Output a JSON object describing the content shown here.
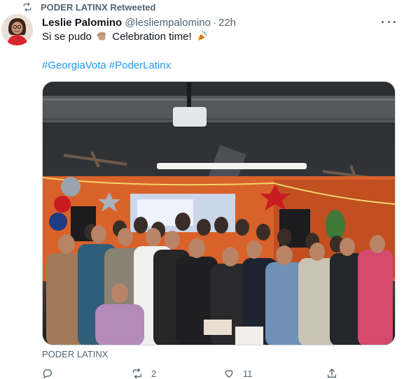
{
  "retweet_banner": {
    "label": "PODER LATINX Retweeted",
    "icon": "retweet-icon"
  },
  "tweet": {
    "author_name": "Leslie Palomino",
    "author_handle": "@lesliempalomino",
    "separator": "·",
    "timestamp": "22h",
    "text_before": "Si se pudo",
    "text_middle": "Celebration time!",
    "emojis": [
      "raised-fist-emoji",
      "party-popper-emoji"
    ],
    "hashtags": [
      "#GeorgiaVota",
      "#PoderLatinx"
    ],
    "media_alt": "Group photo of PODER LATINX volunteers celebrating under a projector",
    "source_label": "PODER LATINX"
  },
  "actions": {
    "reply": {
      "icon": "reply-icon",
      "count": ""
    },
    "retweet": {
      "icon": "retweet-icon",
      "count": "2"
    },
    "like": {
      "icon": "heart-icon",
      "count": "11"
    },
    "share": {
      "icon": "share-icon",
      "count": ""
    }
  },
  "colors": {
    "text": "#0f1419",
    "muted": "#536471",
    "link": "#1d9bf0",
    "border": "#cfd9de"
  }
}
